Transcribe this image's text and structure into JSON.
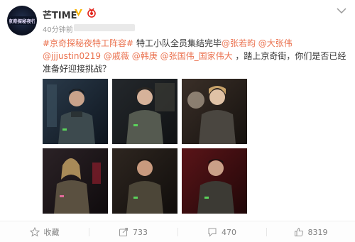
{
  "header": {
    "username": "芒TIME",
    "timestamp": "40分钟前",
    "avatar_text": "京奇探秘夜行"
  },
  "post": {
    "segments": [
      {
        "text": "#京奇探秘夜特工阵容#",
        "link": true
      },
      {
        "text": " 特工小队全员集结完毕",
        "link": false
      },
      {
        "text": "@张若昀",
        "link": true
      },
      {
        "text": " ",
        "link": false
      },
      {
        "text": "@大张伟",
        "link": true
      },
      {
        "text": " ",
        "link": false
      },
      {
        "text": "@jjjustin0219",
        "link": true
      },
      {
        "text": " ",
        "link": false
      },
      {
        "text": "@戚薇",
        "link": true
      },
      {
        "text": " ",
        "link": false
      },
      {
        "text": "@韩庚",
        "link": true
      },
      {
        "text": " ",
        "link": false
      },
      {
        "text": "@张国伟_国家伟大",
        "link": true
      },
      {
        "text": " ，踏上京奇街，你们是否已经准备好迎接挑战？",
        "link": false
      }
    ]
  },
  "actions": {
    "favorite": "收藏",
    "repost": "733",
    "comment": "470",
    "like": "8319"
  },
  "colors": {
    "link": "#eb7350",
    "verified": "#f8b300",
    "text": "#333333",
    "muted": "#999999"
  },
  "icons": {
    "verified": "verified-v-icon",
    "badge": "medal-badge-icon",
    "more": "chevron-down-icon",
    "favorite": "star-icon",
    "repost": "share-icon",
    "comment": "comment-icon",
    "like": "thumbs-up-icon"
  }
}
